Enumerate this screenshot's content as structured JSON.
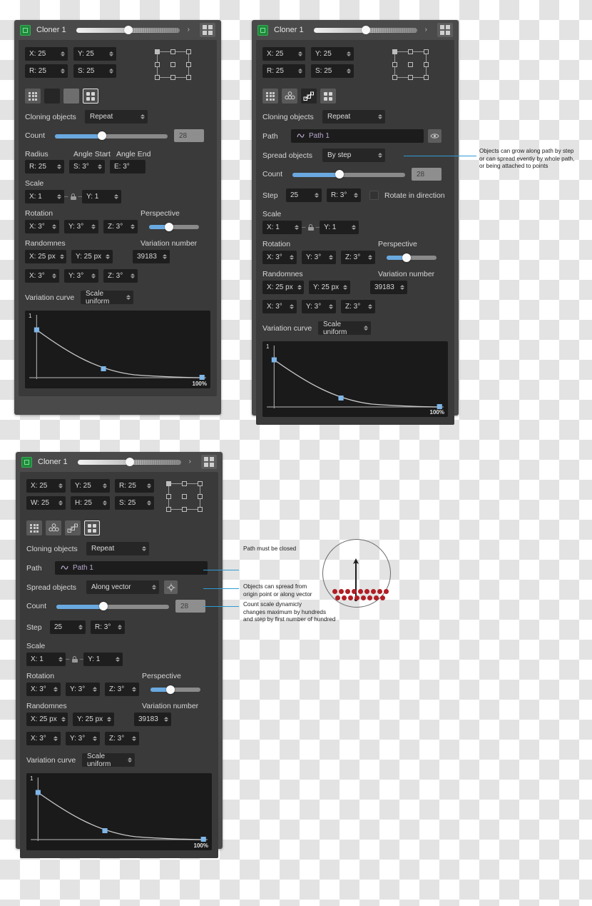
{
  "header": {
    "title": "Cloner 1",
    "app_icon": "cloner-green-icon",
    "grid_icon": "grid-view-icon",
    "slider_value": 42
  },
  "panels": [
    {
      "id": "panel-1-grid-mode",
      "mode_icons": [
        "grid-9-icon",
        "blank-dark-icon",
        "blank-flat-icon",
        "grid-4-icon"
      ],
      "active_mode_index": 3,
      "transform": {
        "fields": [
          {
            "label": "X: 25"
          },
          {
            "label": "Y: 25"
          },
          {
            "label": "R: 25"
          },
          {
            "label": "S: 25"
          }
        ]
      },
      "cloning_objects": {
        "label": "Cloning objects",
        "value": "Repeat"
      },
      "count": {
        "label": "Count",
        "value": "28",
        "percent": 42
      },
      "radius_group": {
        "headers": [
          "Radius",
          "Angle Start",
          "Angle End"
        ],
        "fields": [
          "R: 25",
          "S: 3°",
          "E: 3°"
        ]
      },
      "scale": {
        "label": "Scale",
        "x": "X: 1",
        "y": "Y: 1"
      },
      "rotation": {
        "label": "Rotation",
        "x": "X: 3°",
        "y": "Y: 3°",
        "z": "Z: 3°"
      },
      "perspective": {
        "label": "Perspective",
        "percent": 40
      },
      "randomness": {
        "label": "Randomnes",
        "x_px": "X: 25 px",
        "y_px": "Y: 25 px",
        "rx": "X: 3°",
        "ry": "Y: 3°",
        "rz": "Z: 3°"
      },
      "variation_number": {
        "label": "Variation number",
        "value": "39183"
      },
      "variation_curve": {
        "label": "Variation curve",
        "value": "Scale uniform"
      }
    },
    {
      "id": "panel-2-path-step-mode",
      "mode_icons": [
        "grid-9-icon",
        "circles-cluster-icon",
        "path-nodes-icon",
        "grid-4-icon"
      ],
      "active_mode_index": 2,
      "transform": {
        "fields": [
          {
            "label": "X: 25"
          },
          {
            "label": "Y: 25"
          },
          {
            "label": "R: 25"
          },
          {
            "label": "S: 25"
          }
        ]
      },
      "cloning_objects": {
        "label": "Cloning objects",
        "value": "Repeat"
      },
      "path": {
        "label": "Path",
        "value": "Path 1",
        "path_icon": "wave-path-icon",
        "eye_icon": "eye-visibility-icon"
      },
      "spread_objects": {
        "label": "Spread objects",
        "value": "By step"
      },
      "count": {
        "label": "Count",
        "value": "28",
        "percent": 42
      },
      "step": {
        "label": "Step",
        "value": "25",
        "r": "R: 3°",
        "checkbox_label": "Rotate in direction",
        "checked": false
      },
      "scale": {
        "label": "Scale",
        "x": "X: 1",
        "y": "Y: 1"
      },
      "rotation": {
        "label": "Rotation",
        "x": "X: 3°",
        "y": "Y: 3°",
        "z": "Z: 3°"
      },
      "perspective": {
        "label": "Perspective",
        "percent": 40
      },
      "randomness": {
        "label": "Randomnes",
        "x_px": "X: 25 px",
        "y_px": "Y: 25 px",
        "rx": "X: 3°",
        "ry": "Y: 3°",
        "rz": "Z: 3°"
      },
      "variation_number": {
        "label": "Variation number",
        "value": "39183"
      },
      "variation_curve": {
        "label": "Variation curve",
        "value": "Scale uniform"
      }
    },
    {
      "id": "panel-3-vector-mode",
      "mode_icons": [
        "grid-9-icon",
        "circles-cluster-icon",
        "path-nodes-icon",
        "grid-4-icon"
      ],
      "active_mode_index": 3,
      "transform": {
        "fields": [
          {
            "label": "X: 25"
          },
          {
            "label": "Y: 25"
          },
          {
            "label": "R: 25"
          },
          {
            "label": "W: 25"
          },
          {
            "label": "H: 25"
          },
          {
            "label": "S: 25"
          }
        ]
      },
      "cloning_objects": {
        "label": "Cloning objects",
        "value": "Repeat"
      },
      "path": {
        "label": "Path",
        "value": "Path 1",
        "path_icon": "wave-path-icon"
      },
      "spread_objects": {
        "label": "Spread objects",
        "value": "Along vector",
        "target_icon": "target-crosshair-icon"
      },
      "count": {
        "label": "Count",
        "value": "28",
        "percent": 42
      },
      "step": {
        "label": "Step",
        "value": "25",
        "r": "R: 3°"
      },
      "scale": {
        "label": "Scale",
        "x": "X: 1",
        "y": "Y: 1"
      },
      "rotation": {
        "label": "Rotation",
        "x": "X: 3°",
        "y": "Y: 3°",
        "z": "Z: 3°"
      },
      "perspective": {
        "label": "Perspective",
        "percent": 40
      },
      "randomness": {
        "label": "Randomnes",
        "x_px": "X: 25 px",
        "y_px": "Y: 25 px",
        "rx": "X: 3°",
        "ry": "Y: 3°",
        "rz": "Z: 3°"
      },
      "variation_number": {
        "label": "Variation number",
        "value": "39183"
      },
      "variation_curve": {
        "label": "Variation curve",
        "value": "Scale uniform"
      }
    }
  ],
  "curve_graph": {
    "y_label": "1",
    "x_label": "100%"
  },
  "annotations": {
    "path_step": "Objects  can grow along path by step\nor can spread eventiy by whole path,\nor being attached to points",
    "path_closed": "Path must be closed",
    "spread_origin": "Objects can spread from\norigin point or along vector",
    "count_scale": "Count scale dynamicly\nchanges maximum by hundreds\nand step by first number of hundred"
  },
  "colors": {
    "accent_blue": "#6aa9e0",
    "leader_blue": "#2d9cd4",
    "panel_bg": "#3a3a3a",
    "panel_shell": "#4a4a4a",
    "field_bg": "#1e1e1e",
    "dot_red": "#b01e24",
    "app_green": "#1f8a3b",
    "path_purple": "#b8a8cf"
  }
}
